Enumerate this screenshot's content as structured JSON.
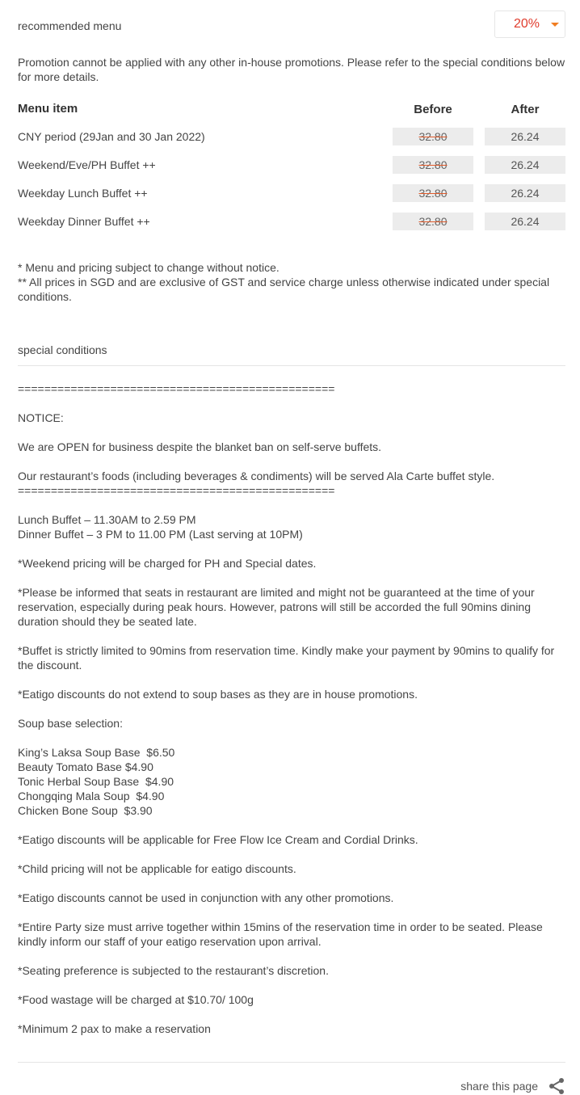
{
  "header": {
    "title": "recommended menu",
    "discount": "20%"
  },
  "promo_note": "Promotion cannot be applied with any other in-house promotions. Please refer to the special conditions below for more details.",
  "menu_table": {
    "col_item": "Menu item",
    "col_before": "Before",
    "col_after": "After",
    "rows": [
      {
        "name": "CNY period (29Jan and 30 Jan 2022)",
        "before": "32.80",
        "after": "26.24"
      },
      {
        "name": "Weekend/Eve/PH Buffet ++",
        "before": "32.80",
        "after": "26.24"
      },
      {
        "name": "Weekday Lunch Buffet ++",
        "before": "32.80",
        "after": "26.24"
      },
      {
        "name": "Weekday Dinner Buffet ++",
        "before": "32.80",
        "after": "26.24"
      }
    ]
  },
  "footnotes": [
    "* Menu and pricing subject to change without notice.",
    "** All prices in SGD and are exclusive of GST and service charge unless otherwise indicated under special conditions."
  ],
  "special_title": "special conditions",
  "conditions": [
    "================================================",
    "",
    "NOTICE:",
    "",
    "We are OPEN for business despite the blanket ban on self-serve buffets.",
    "",
    "Our restaurant’s foods (including beverages & condiments) will be served Ala Carte buffet style.",
    "================================================",
    "",
    "Lunch Buffet – 11.30AM to 2.59 PM",
    "Dinner Buffet – 3 PM to 11.00 PM (Last serving at 10PM)",
    "",
    "*Weekend pricing will be charged for PH and Special dates.",
    "",
    "*Please be informed that seats in restaurant are limited and might not be guaranteed at the time of your reservation, especially during peak hours. However, patrons will still be accorded the full 90mins dining duration should they be seated late.",
    "",
    "*Buffet is strictly limited to 90mins from reservation time. Kindly make your payment by 90mins to qualify for the discount.",
    "",
    "*Eatigo discounts do not extend to soup bases as they are in house promotions.",
    "",
    "Soup base selection:",
    "",
    "King’s Laksa Soup Base  $6.50",
    "Beauty Tomato Base $4.90",
    "Tonic Herbal Soup Base  $4.90",
    "Chongqing Mala Soup  $4.90",
    "Chicken Bone Soup  $3.90",
    "",
    "*Eatigo discounts will be applicable for Free Flow Ice Cream and Cordial Drinks.",
    "",
    "*Child pricing will not be applicable for eatigo discounts.",
    "",
    "*Eatigo discounts cannot be used in conjunction with any other promotions.",
    "",
    "*Entire Party size must arrive together within 15mins of the reservation time in order to be seated. Please kindly inform our staff of your eatigo reservation upon arrival.",
    "",
    "*Seating preference is subjected to the restaurant’s discretion.",
    "",
    "*Food wastage will be charged at $10.70/ 100g",
    "",
    "*Minimum 2 pax to make a reservation"
  ],
  "share": {
    "label": "share this page",
    "icon": "share-icon"
  },
  "colors": {
    "accent": "#f07d22",
    "discount_text": "#e03c2d",
    "price_bg": "#ececec"
  }
}
